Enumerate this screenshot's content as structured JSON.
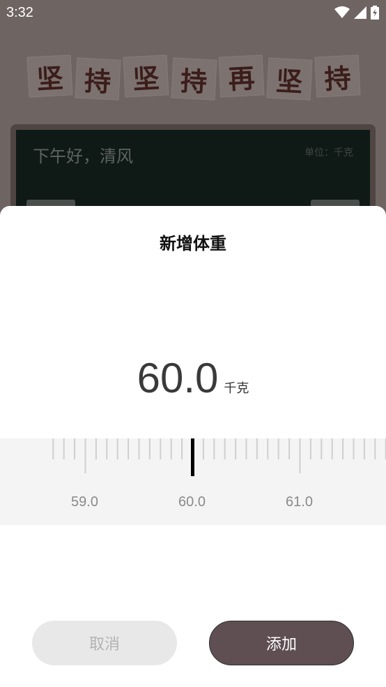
{
  "status_bar": {
    "time": "3:32",
    "icons": [
      "wifi-icon",
      "signal-icon",
      "battery-charging-icon"
    ]
  },
  "background_app": {
    "banner_chars": [
      "坚",
      "持",
      "坚",
      "持",
      "再",
      "坚",
      "持"
    ],
    "greeting": "下午好，清风",
    "unit_label": "单位：千克"
  },
  "dialog": {
    "title": "新增体重",
    "value": "60.0",
    "unit": "千克",
    "ruler": {
      "min_visible": 58.8,
      "max_visible": 61.8,
      "step": 0.1,
      "selected": 60.0,
      "labels": [
        "59.0",
        "60.0",
        "61.0"
      ]
    },
    "cancel_label": "取消",
    "add_label": "添加"
  },
  "colors": {
    "accent": "#5f4f53",
    "chalkboard": "#0f1a16",
    "backdrop": "#6e6462"
  }
}
